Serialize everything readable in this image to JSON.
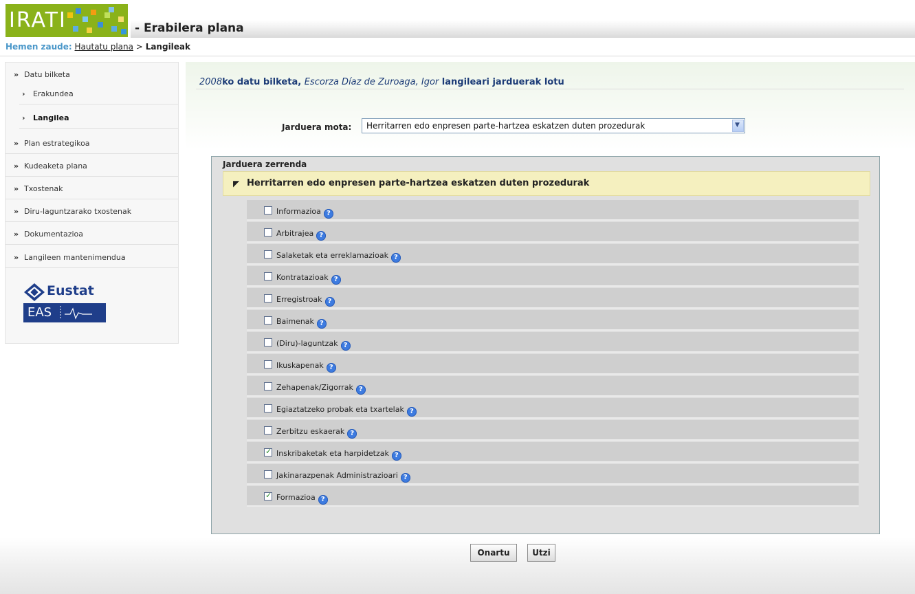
{
  "header": {
    "logo_text": "IRATI",
    "app_title": "- Erabilera plana"
  },
  "breadcrumb": {
    "prefix": "Hemen zaude:",
    "link": "Hautatu plana",
    "separator": ">",
    "current": "Langileak"
  },
  "sidebar": {
    "items": [
      {
        "arrow": "»",
        "label": "Datu bilketa"
      },
      {
        "arrow": "›",
        "label": "Erakundea"
      },
      {
        "arrow": "›",
        "label": "Langilea"
      },
      {
        "arrow": "»",
        "label": "Plan estrategikoa"
      },
      {
        "arrow": "»",
        "label": "Kudeaketa plana"
      },
      {
        "arrow": "»",
        "label": "Txostenak"
      },
      {
        "arrow": "»",
        "label": "Diru-laguntzarako txostenak"
      },
      {
        "arrow": "»",
        "label": "Dokumentazioa"
      },
      {
        "arrow": "»",
        "label": "Langileen mantenimendua"
      }
    ],
    "eustat_label": "Eustat",
    "eas_label": "EAS"
  },
  "main": {
    "heading_year": "2008",
    "heading_mid": "ko datu bilketa, ",
    "heading_name": "Escorza Díaz de Zuroaga, Igor",
    "heading_tail": " langileari jarduerak lotu",
    "filter_label": "Jarduera mota:",
    "filter_value": "Herritarren edo enpresen parte-hartzea eskatzen duten prozedurak",
    "panel_title": "Jarduera zerrenda",
    "group_title": "Herritarren edo enpresen parte-hartzea eskatzen duten prozedurak",
    "activities": [
      {
        "label": "Informazioa",
        "checked": false
      },
      {
        "label": "Arbitrajea",
        "checked": false
      },
      {
        "label": "Salaketak eta erreklamazioak",
        "checked": false
      },
      {
        "label": "Kontratazioak",
        "checked": false
      },
      {
        "label": "Erregistroak",
        "checked": false
      },
      {
        "label": "Baimenak",
        "checked": false
      },
      {
        "label": "(Diru)-laguntzak",
        "checked": false
      },
      {
        "label": "Ikuskapenak",
        "checked": false
      },
      {
        "label": "Zehapenak/Zigorrak",
        "checked": false
      },
      {
        "label": "Egiaztatzeko probak eta txartelak",
        "checked": false
      },
      {
        "label": "Zerbitzu eskaerak",
        "checked": false
      },
      {
        "label": "Inskribaketak eta harpidetzak",
        "checked": true
      },
      {
        "label": "Jakinarazpenak Administrazioari",
        "checked": false
      },
      {
        "label": "Formazioa",
        "checked": true
      }
    ]
  },
  "buttons": {
    "ok": "Onartu",
    "cancel": "Utzi"
  },
  "icons": {
    "help": "?",
    "check": "✓",
    "dropdown": "▼",
    "collapse": "◤"
  }
}
